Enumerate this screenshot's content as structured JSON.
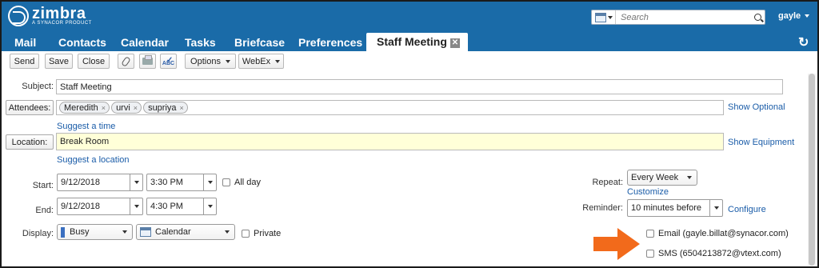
{
  "app": {
    "logo_word": "zimbra",
    "logo_sub": "A SYNACOR PRODUCT",
    "search": {
      "placeholder": "Search"
    },
    "user": "gayle"
  },
  "tabs": [
    "Mail",
    "Contacts",
    "Calendar",
    "Tasks",
    "Briefcase",
    "Preferences"
  ],
  "active_tab": {
    "label": "Staff Meeting",
    "close": "✕"
  },
  "toolbar": {
    "send": "Send",
    "save": "Save",
    "close": "Close",
    "options": "Options",
    "webex": "WebEx",
    "spell_text": "ABC"
  },
  "form": {
    "subject_label": "Subject:",
    "subject_value": "Staff Meeting",
    "attendees_label": "Attendees:",
    "attendees": [
      "Meredith",
      "urvi",
      "supriya"
    ],
    "chip_remove": "×",
    "show_optional": "Show Optional",
    "suggest_time": "Suggest a time",
    "location_label": "Location:",
    "location_value": "Break Room",
    "show_equipment": "Show Equipment",
    "suggest_location": "Suggest a location",
    "start_label": "Start:",
    "start_date": "9/12/2018",
    "start_time": "3:30 PM",
    "all_day": "All day",
    "end_label": "End:",
    "end_date": "9/12/2018",
    "end_time": "4:30 PM",
    "display_label": "Display:",
    "display_value": "Busy",
    "calendar_value": "Calendar",
    "private_label": "Private",
    "repeat_label": "Repeat:",
    "repeat_value": "Every Week",
    "customize": "Customize",
    "reminder_label": "Reminder:",
    "reminder_value": "10 minutes before",
    "configure": "Configure",
    "email_reminder": "Email (gayle.billat@synacor.com)",
    "sms_reminder": "SMS (6504213872@vtext.com)"
  },
  "colors": {
    "header_blue": "#1a6ba8",
    "link_blue": "#1a5ca8",
    "location_bg": "#ffffd8",
    "arrow_orange": "#f26a1b"
  }
}
